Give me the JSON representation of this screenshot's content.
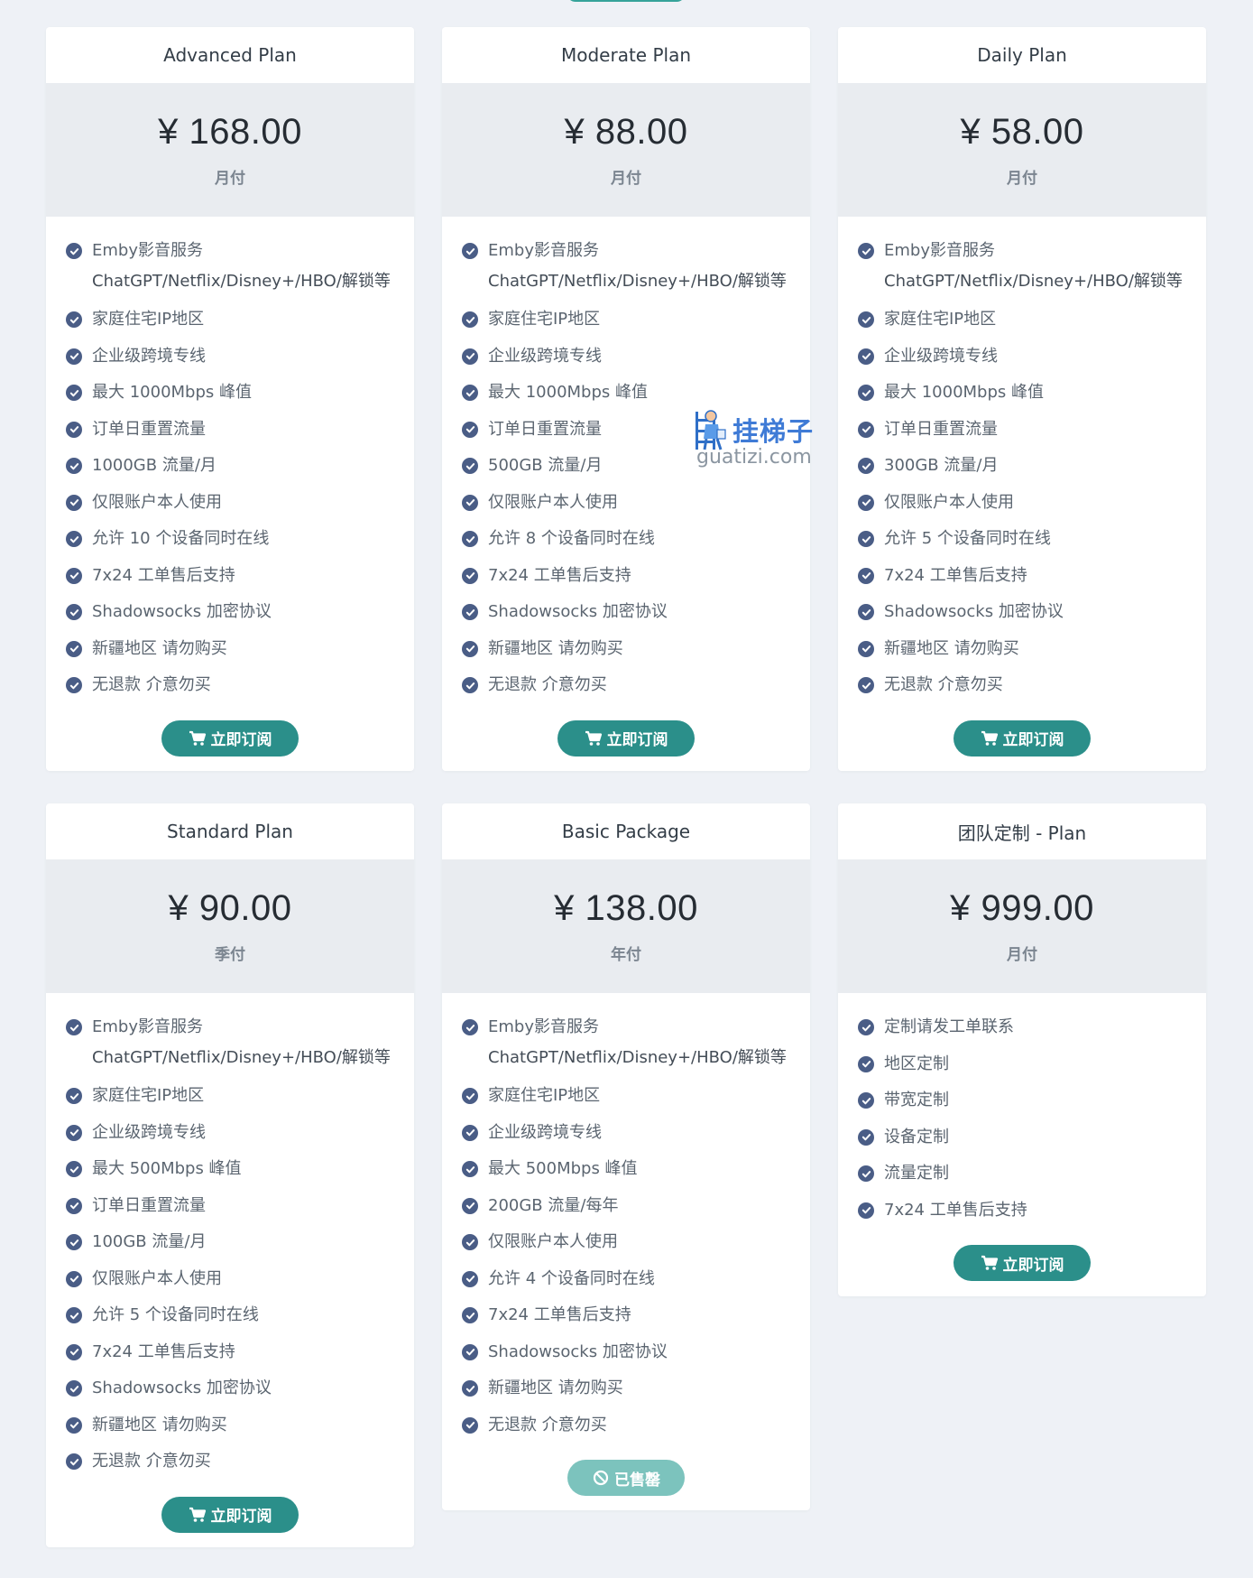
{
  "colors": {
    "accent": "#2b8f8a",
    "check": "#4a5d86",
    "price_bg": "#e9ecf0",
    "page_bg": "#eef1f6",
    "disabled": "#7cc3bd"
  },
  "watermark": {
    "cn": "挂梯子",
    "en": "guatizi.com"
  },
  "plans": [
    {
      "title": "Advanced Plan",
      "price": "¥ 168.00",
      "period": "月付",
      "features": [
        {
          "text": "Emby影音服务",
          "sub": "ChatGPT/Netflix/Disney+/HBO/解锁等"
        },
        {
          "text": "家庭住宅IP地区"
        },
        {
          "text": "企业级跨境专线"
        },
        {
          "text": "最大 1000Mbps 峰值"
        },
        {
          "text": "订单日重置流量"
        },
        {
          "text": "1000GB 流量/月"
        },
        {
          "text": "仅限账户本人使用"
        },
        {
          "text": "允许 10 个设备同时在线"
        },
        {
          "text": "7x24 工单售后支持"
        },
        {
          "text": "Shadowsocks 加密协议"
        },
        {
          "text": "新疆地区 请勿购买"
        },
        {
          "text": "无退款 介意勿买"
        }
      ],
      "button": {
        "label": "立即订阅",
        "icon": "cart-icon",
        "disabled": false
      }
    },
    {
      "title": "Moderate Plan",
      "price": "¥ 88.00",
      "period": "月付",
      "features": [
        {
          "text": "Emby影音服务",
          "sub": "ChatGPT/Netflix/Disney+/HBO/解锁等"
        },
        {
          "text": "家庭住宅IP地区"
        },
        {
          "text": "企业级跨境专线"
        },
        {
          "text": "最大 1000Mbps 峰值"
        },
        {
          "text": "订单日重置流量"
        },
        {
          "text": "500GB 流量/月"
        },
        {
          "text": "仅限账户本人使用"
        },
        {
          "text": "允许 8 个设备同时在线"
        },
        {
          "text": "7x24 工单售后支持"
        },
        {
          "text": "Shadowsocks 加密协议"
        },
        {
          "text": "新疆地区 请勿购买"
        },
        {
          "text": "无退款 介意勿买"
        }
      ],
      "button": {
        "label": "立即订阅",
        "icon": "cart-icon",
        "disabled": false
      }
    },
    {
      "title": "Daily Plan",
      "price": "¥ 58.00",
      "period": "月付",
      "features": [
        {
          "text": "Emby影音服务",
          "sub": "ChatGPT/Netflix/Disney+/HBO/解锁等"
        },
        {
          "text": "家庭住宅IP地区"
        },
        {
          "text": "企业级跨境专线"
        },
        {
          "text": "最大 1000Mbps 峰值"
        },
        {
          "text": "订单日重置流量"
        },
        {
          "text": "300GB 流量/月"
        },
        {
          "text": "仅限账户本人使用"
        },
        {
          "text": "允许 5 个设备同时在线"
        },
        {
          "text": "7x24 工单售后支持"
        },
        {
          "text": "Shadowsocks 加密协议"
        },
        {
          "text": "新疆地区 请勿购买"
        },
        {
          "text": "无退款 介意勿买"
        }
      ],
      "button": {
        "label": "立即订阅",
        "icon": "cart-icon",
        "disabled": false
      }
    },
    {
      "title": "Standard Plan",
      "price": "¥ 90.00",
      "period": "季付",
      "features": [
        {
          "text": "Emby影音服务",
          "sub": "ChatGPT/Netflix/Disney+/HBO/解锁等"
        },
        {
          "text": "家庭住宅IP地区"
        },
        {
          "text": "企业级跨境专线"
        },
        {
          "text": "最大 500Mbps 峰值"
        },
        {
          "text": "订单日重置流量"
        },
        {
          "text": "100GB 流量/月"
        },
        {
          "text": "仅限账户本人使用"
        },
        {
          "text": "允许 5 个设备同时在线"
        },
        {
          "text": "7x24 工单售后支持"
        },
        {
          "text": "Shadowsocks 加密协议"
        },
        {
          "text": "新疆地区 请勿购买"
        },
        {
          "text": "无退款 介意勿买"
        }
      ],
      "button": {
        "label": "立即订阅",
        "icon": "cart-icon",
        "disabled": false
      }
    },
    {
      "title": "Basic Package",
      "price": "¥ 138.00",
      "period": "年付",
      "features": [
        {
          "text": "Emby影音服务",
          "sub": "ChatGPT/Netflix/Disney+/HBO/解锁等"
        },
        {
          "text": "家庭住宅IP地区"
        },
        {
          "text": "企业级跨境专线"
        },
        {
          "text": "最大 500Mbps 峰值"
        },
        {
          "text": "200GB 流量/每年"
        },
        {
          "text": "仅限账户本人使用"
        },
        {
          "text": "允许 4 个设备同时在线"
        },
        {
          "text": "7x24 工单售后支持"
        },
        {
          "text": "Shadowsocks 加密协议"
        },
        {
          "text": "新疆地区 请勿购买"
        },
        {
          "text": "无退款 介意勿买"
        }
      ],
      "button": {
        "label": "已售罄",
        "icon": "ban-icon",
        "disabled": true
      }
    },
    {
      "title": "团队定制 - Plan",
      "price": "¥ 999.00",
      "period": "月付",
      "features": [
        {
          "text": "定制请发工单联系"
        },
        {
          "text": "地区定制"
        },
        {
          "text": "带宽定制"
        },
        {
          "text": "设备定制"
        },
        {
          "text": "流量定制"
        },
        {
          "text": "7x24 工单售后支持"
        }
      ],
      "button": {
        "label": "立即订阅",
        "icon": "cart-icon",
        "disabled": false
      }
    }
  ]
}
